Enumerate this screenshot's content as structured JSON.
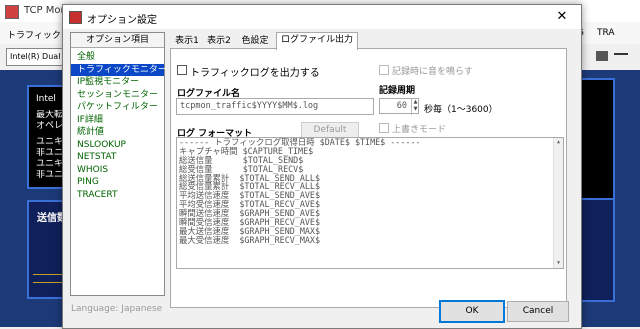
{
  "background": {
    "title": "TCP Moni",
    "menu_left": "トラフィックモニ",
    "menu_right": [
      "G",
      "TRA"
    ],
    "adapter_combo": "Intel(R) Dual B",
    "panel_lines": [
      "Intel",
      "最大転",
      "オペレ",
      "",
      "ユニキ",
      "非ユニ",
      "ユニキ",
      "非ユニ"
    ],
    "panel2_header": "送信数"
  },
  "dialog": {
    "title": "オプション設定",
    "close_glyph": "✕",
    "options_header": "オプション項目",
    "options": [
      "全般",
      "トラフィックモニター",
      "IP監視モニター",
      "セッションモニター",
      "パケットフィルター",
      "IF詳細",
      "統計値",
      "NSLOOKUP",
      "NETSTAT",
      "WHOIS",
      "PING",
      "TRACERT"
    ],
    "selected_option": "トラフィックモニター",
    "tabs": [
      "表示1",
      "表示2",
      "色設定",
      "ログファイル出力"
    ],
    "active_tab": "ログファイル出力",
    "log_output_label": "トラフィックログを出力する",
    "sound_label": "記録時に音を鳴らす",
    "filename_label": "ログファイル名",
    "filename_value": "tcpmon_traffic$YYYY$MM$.log",
    "period_label": "記録周期",
    "period_value": "60",
    "period_unit": "秒毎（1〜3600）",
    "overwrite_label": "上書きモード",
    "format_label": "ログ フォーマット",
    "default_button": "Default",
    "format_lines": [
      "------ トラフィックログ取得日時 $DATE$ $TIME$ ------",
      "キャプチャ時間 $CAPTURE_TIME$",
      "総送信量      $TOTAL_SEND$",
      "総受信量      $TOTAL_RECV$",
      "総送信量累計  $TOTAL_SEND_ALL$",
      "総受信量累計  $TOTAL_RECV_ALL$",
      "平均送信速度  $TOTAL_SEND_AVE$",
      "平均受信速度  $TOTAL_RECV_AVE$",
      "瞬間送信速度  $GRAPH_SEND_AVE$",
      "瞬間受信速度  $GRAPH_RECV_AVE$",
      "最大送信速度  $GRAPH_SEND_MAX$",
      "最大受信速度  $GRAPH_RECV_MAX$"
    ],
    "language": "Language: Japanese",
    "ok_button": "OK",
    "cancel_button": "Cancel"
  }
}
